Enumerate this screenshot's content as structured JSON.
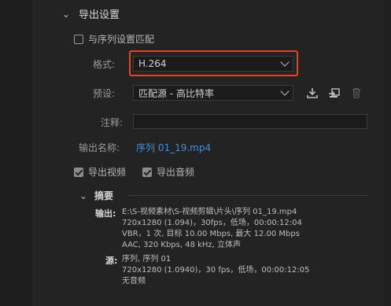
{
  "export_settings": {
    "section_title": "导出设置",
    "match_sequence_label": "与序列设置匹配",
    "match_sequence_checked": false,
    "format_label": "格式:",
    "format_value": "H.264",
    "preset_label": "预设:",
    "preset_value": "匹配源 - 高比特率",
    "comment_label": "注释:",
    "comment_value": "",
    "output_name_label": "输出名称:",
    "output_name_value": "序列 01_19.mp4",
    "export_video_label": "导出视频",
    "export_video_checked": true,
    "export_audio_label": "导出音频",
    "export_audio_checked": true,
    "icons": [
      "save-preset-icon",
      "import-preset-icon",
      "delete-preset-icon"
    ]
  },
  "summary": {
    "title": "摘要",
    "output_label": "输出:",
    "output_lines": [
      "E:\\S-视频素材\\S-视频剪辑\\片头\\序列 01_19.mp4",
      "720x1280 (1.094)，30fps，低场，00:00:12:04",
      "VBR，1 次, 目标 10.00 Mbps, 最大 12.00 Mbps",
      "AAC, 320 Kbps, 48 kHz, 立体声"
    ],
    "source_label": "源:",
    "source_lines": [
      "序列, 序列 01",
      "720x1280 (1.0940)，30 fps，低场，00:00:12:05",
      "无音频"
    ]
  },
  "colors": {
    "accent_link": "#3d8fe0",
    "highlight_border": "#e8431c",
    "background": "#232323"
  }
}
